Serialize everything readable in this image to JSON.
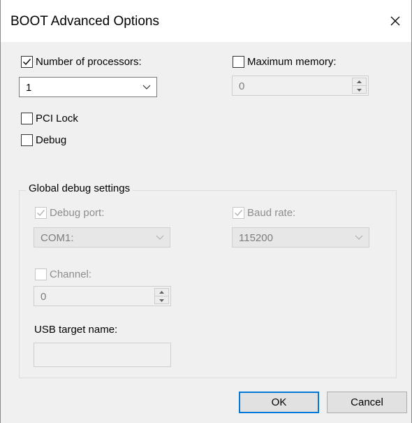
{
  "window": {
    "title": "BOOT Advanced Options"
  },
  "processors": {
    "label": "Number of processors:",
    "checked": true,
    "value": "1"
  },
  "memory": {
    "label": "Maximum memory:",
    "checked": false,
    "value": "0"
  },
  "pci_lock": {
    "label": "PCI Lock",
    "checked": false
  },
  "debug": {
    "label": "Debug",
    "checked": false
  },
  "debug_settings": {
    "group_label": "Global debug settings",
    "debug_port": {
      "label": "Debug port:",
      "checked": true,
      "value": "COM1:"
    },
    "baud_rate": {
      "label": "Baud rate:",
      "checked": true,
      "value": "115200"
    },
    "channel": {
      "label": "Channel:",
      "checked": false,
      "value": "0"
    },
    "usb_target": {
      "label": "USB target name:",
      "value": ""
    }
  },
  "buttons": {
    "ok": "OK",
    "cancel": "Cancel"
  },
  "colors": {
    "accent": "#0078d7",
    "disabled_text": "#8d8d8d",
    "background": "#f0f0f0"
  }
}
